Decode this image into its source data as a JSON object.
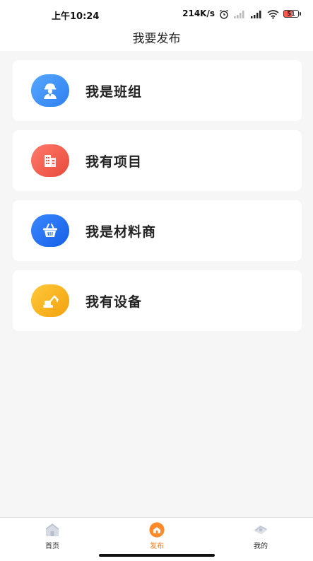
{
  "status_bar": {
    "time": "上午10:24",
    "net_speed": "214K/s",
    "battery_level": "51"
  },
  "header": {
    "title": "我要发布"
  },
  "cards": [
    {
      "label": "我是班组",
      "icon": "worker-icon",
      "color": "#3d8ff2"
    },
    {
      "label": "我有项目",
      "icon": "building-icon",
      "color": "#f2584a"
    },
    {
      "label": "我是材料商",
      "icon": "basket-icon",
      "color": "#1f6ff0"
    },
    {
      "label": "我有设备",
      "icon": "excavator-icon",
      "color": "#f5b21a"
    }
  ],
  "bottom_nav": {
    "items": [
      {
        "label": "首页",
        "icon": "home-icon",
        "active": false
      },
      {
        "label": "发布",
        "icon": "publish-icon",
        "active": true
      },
      {
        "label": "我的",
        "icon": "profile-icon",
        "active": false
      }
    ],
    "active_color": "#ff7a1a"
  }
}
